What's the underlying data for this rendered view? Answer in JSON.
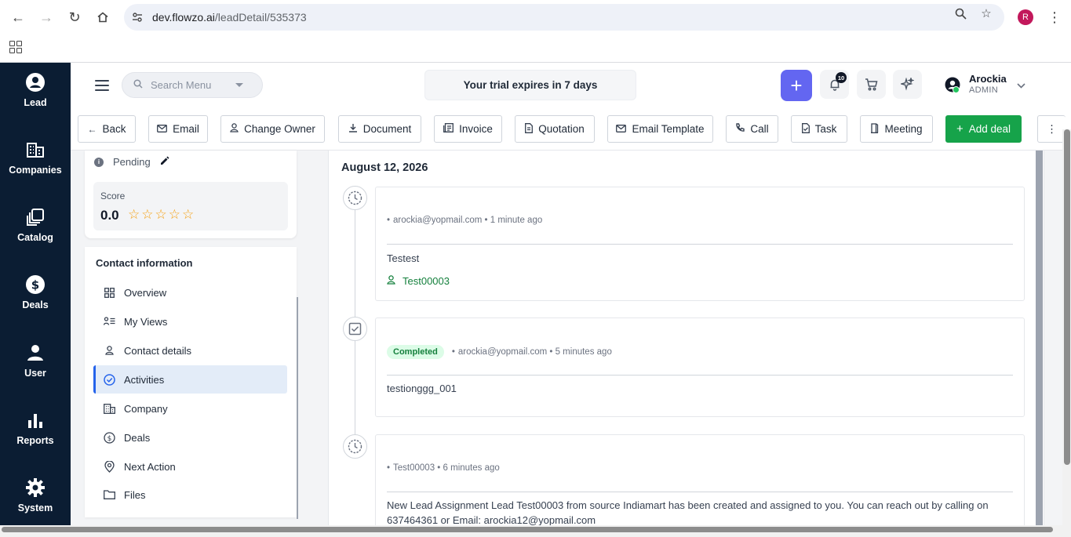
{
  "browser": {
    "url_domain": "dev.flowzo.ai",
    "url_path": "/leadDetail/535373",
    "profile_initial": "R"
  },
  "leftnav": {
    "items": [
      {
        "label": "Lead",
        "icon": "account-circle-icon"
      },
      {
        "label": "Companies",
        "icon": "building-icon"
      },
      {
        "label": "Catalog",
        "icon": "catalog-icon"
      },
      {
        "label": "Deals",
        "icon": "dollar-icon"
      },
      {
        "label": "User",
        "icon": "user-icon"
      },
      {
        "label": "Reports",
        "icon": "bar-chart-icon"
      },
      {
        "label": "System",
        "icon": "gear-icon"
      }
    ]
  },
  "header": {
    "search_placeholder": "Search Menu",
    "trial_text": "Your trial expires in 7 days",
    "notification_count": "10",
    "user_name": "Arockia",
    "user_role": "ADMIN"
  },
  "toolbar": {
    "buttons": [
      {
        "label": "Back",
        "icon": "arrow-left-icon"
      },
      {
        "label": "Email",
        "icon": "mail-icon"
      },
      {
        "label": "Change Owner",
        "icon": "user-icon"
      },
      {
        "label": "Document",
        "icon": "download-icon"
      },
      {
        "label": "Invoice",
        "icon": "invoice-icon"
      },
      {
        "label": "Quotation",
        "icon": "file-icon"
      },
      {
        "label": "Email Template",
        "icon": "mail-icon"
      },
      {
        "label": "Call",
        "icon": "phone-icon"
      },
      {
        "label": "Task",
        "icon": "task-icon"
      },
      {
        "label": "Meeting",
        "icon": "door-icon"
      },
      {
        "label": "Add deal",
        "icon": "plus-icon"
      }
    ]
  },
  "left_panel": {
    "status": "Pending",
    "score_label": "Score",
    "score_value": "0.0",
    "rating": 0,
    "contact_title": "Contact information",
    "items": [
      {
        "label": "Overview",
        "icon": "grid-icon"
      },
      {
        "label": "My Views",
        "icon": "list-user-icon"
      },
      {
        "label": "Contact details",
        "icon": "user-icon"
      },
      {
        "label": "Activities",
        "icon": "check-circle-icon"
      },
      {
        "label": "Company",
        "icon": "building-icon"
      },
      {
        "label": "Deals",
        "icon": "dollar-circle-icon"
      },
      {
        "label": "Next Action",
        "icon": "location-icon"
      },
      {
        "label": "Files",
        "icon": "folder-icon"
      }
    ],
    "active_item": "Activities"
  },
  "timeline": {
    "date": "August 12, 2026",
    "entries": [
      {
        "icon": "clock-icon",
        "author": "arockia@yopmail.com",
        "time": "1 minute ago",
        "text": "Testest",
        "link": "Test00003"
      },
      {
        "icon": "checkbox-icon",
        "badge": "Completed",
        "author": "arockia@yopmail.com",
        "time": "5 minutes ago",
        "text": "testionggg_001"
      },
      {
        "icon": "clock-icon",
        "author": "Test00003",
        "time": "6 minutes ago",
        "text": "New Lead Assignment Lead Test00003 from source Indiamart has been created and assigned to you. You can reach out by calling on 637464361 or Email: arockia12@yopmail.com"
      }
    ]
  },
  "colors": {
    "sidebar_bg": "#0b1d33",
    "accent": "#6366f1",
    "add_deal": "#16a34a",
    "active_item_bg": "#e3ecf8",
    "star": "#f59e0b"
  }
}
